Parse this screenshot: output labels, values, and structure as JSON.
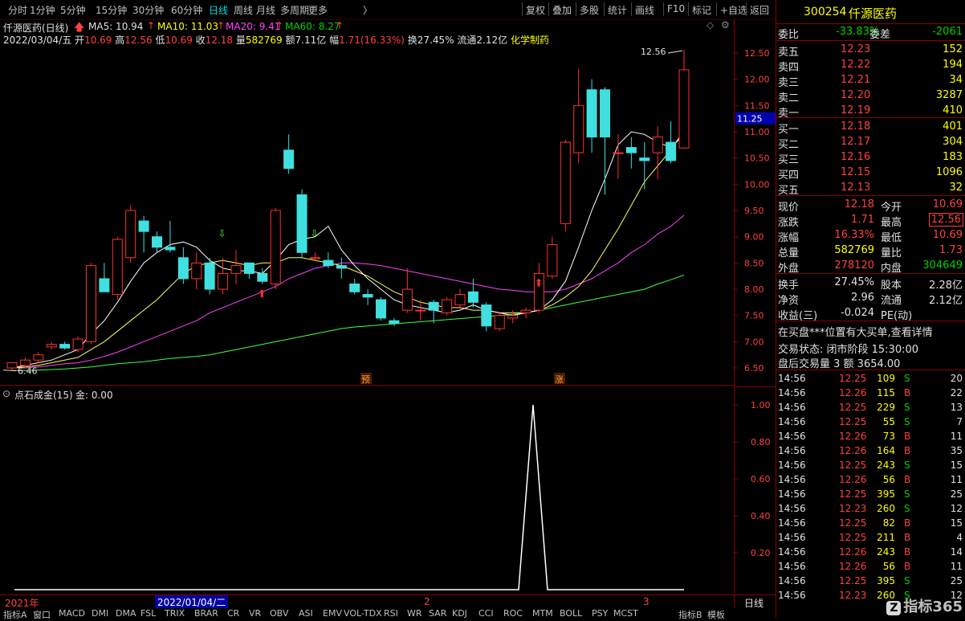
{
  "toolbar": {
    "periods": [
      "分时",
      "1分钟",
      "5分钟",
      "15分钟",
      "30分钟",
      "60分钟",
      "日线",
      "周线",
      "月线",
      "多周期",
      "更多"
    ],
    "active_period": "日线",
    "actions": [
      "复权",
      "叠加",
      "多股",
      "统计",
      "画线",
      "F10",
      "标记",
      "+自选",
      "返回"
    ]
  },
  "info": {
    "title": "仟源医药(日线)",
    "ma5": "MA5: 10.94",
    "ma10": "MA10: 11.03",
    "ma20": "MA20: 9.41",
    "ma60": "MA60: 8.27",
    "date": "2022/03/04/五",
    "open_label": "开",
    "open": "10.69",
    "high_label": "高",
    "high": "12.56",
    "low_label": "低",
    "low": "10.69",
    "close_label": "收",
    "close": "12.18",
    "vol_label": "量",
    "vol": "582769",
    "amount_label": "额",
    "amount": "7.11亿",
    "change_label": "幅",
    "change": "1.71(16.33%)",
    "turnover_label": "换",
    "turnover": "27.45%",
    "float_label": "流通",
    "float": "2.12亿",
    "sector": "化学制药"
  },
  "price_axis": {
    "ticks": [
      "12.50",
      "12.00",
      "11.50",
      "11.00",
      "10.50",
      "10.00",
      "9.50",
      "9.00",
      "8.50",
      "8.00",
      "7.50",
      "7.00",
      "6.50"
    ],
    "current": "11.25",
    "high_mark": "12.56",
    "low_mark": "6.46"
  },
  "markers": {
    "pre": "预",
    "up": "涨"
  },
  "indicator": {
    "title": "点石成金(15)",
    "value_label": "金: 0.00",
    "ticks": [
      "1.00",
      "0.80",
      "0.60",
      "0.40",
      "0.20"
    ]
  },
  "date_axis": {
    "labels": [
      "2021年",
      "2022/01/04/二",
      "2",
      "3"
    ],
    "right": "日线"
  },
  "bottom_tabs": [
    "指标A",
    "窗口",
    "MACD",
    "DMI",
    "DMA",
    "FSL",
    "TRIX",
    "BRAR",
    "CR",
    "VR",
    "OBV",
    "ASI",
    "EMV",
    "VOL-TDX",
    "RSI",
    "WR",
    "SAR",
    "KDJ",
    "CCI",
    "ROC",
    "MTM",
    "BOLL",
    "PSY",
    "MCST",
    "指标B",
    "模板"
  ],
  "quote": {
    "code": "300254",
    "name": "仟源医药",
    "webi_label": "委比",
    "webi": "-33.83%",
    "weicha_label": "委差",
    "weicha": "-2061",
    "asks": [
      {
        "label": "卖五",
        "price": "12.23",
        "vol": "152"
      },
      {
        "label": "卖四",
        "price": "12.22",
        "vol": "194"
      },
      {
        "label": "卖三",
        "price": "12.21",
        "vol": "34"
      },
      {
        "label": "卖二",
        "price": "12.20",
        "vol": "3287"
      },
      {
        "label": "卖一",
        "price": "12.19",
        "vol": "410"
      }
    ],
    "bids": [
      {
        "label": "买一",
        "price": "12.18",
        "vol": "401"
      },
      {
        "label": "买二",
        "price": "12.17",
        "vol": "304"
      },
      {
        "label": "买三",
        "price": "12.16",
        "vol": "183"
      },
      {
        "label": "买四",
        "price": "12.15",
        "vol": "1096"
      },
      {
        "label": "买五",
        "price": "12.13",
        "vol": "32"
      }
    ],
    "stats": [
      {
        "l1": "现价",
        "v1": "12.18",
        "l2": "今开",
        "v2": "10.69"
      },
      {
        "l1": "涨跌",
        "v1": "1.71",
        "l2": "最高",
        "v2": "12.56"
      },
      {
        "l1": "涨幅",
        "v1": "16.33%",
        "l2": "最低",
        "v2": "10.69"
      },
      {
        "l1": "总量",
        "v1": "582769",
        "l2": "量比",
        "v2": "1.73"
      },
      {
        "l1": "外盘",
        "v1": "278120",
        "l2": "内盘",
        "v2": "304649"
      }
    ],
    "stats2": [
      {
        "l1": "换手",
        "v1": "27.45%",
        "l2": "股本",
        "v2": "2.28亿"
      },
      {
        "l1": "净资",
        "v1": "2.96",
        "l2": "流通",
        "v2": "2.12亿"
      },
      {
        "l1": "收益(三)",
        "v1": "-0.024",
        "l2": "PE(动)",
        "v2": ""
      }
    ],
    "notice": "在买盘***位置有大买单,查看详情",
    "trade_status": "交易状态: 闭市阶段 15:30:00",
    "after_hours": "盘后交易量 3 额 3654.00"
  },
  "ticks": [
    {
      "t": "14:56",
      "p": "12.25",
      "v": "109",
      "s": "S",
      "n": "20"
    },
    {
      "t": "14:56",
      "p": "12.26",
      "v": "115",
      "s": "B",
      "n": "22"
    },
    {
      "t": "14:56",
      "p": "12.25",
      "v": "229",
      "s": "S",
      "n": "13"
    },
    {
      "t": "14:56",
      "p": "12.25",
      "v": "55",
      "s": "S",
      "n": "7"
    },
    {
      "t": "14:56",
      "p": "12.26",
      "v": "73",
      "s": "B",
      "n": "11"
    },
    {
      "t": "14:56",
      "p": "12.26",
      "v": "164",
      "s": "B",
      "n": "35"
    },
    {
      "t": "14:56",
      "p": "12.25",
      "v": "243",
      "s": "S",
      "n": "15"
    },
    {
      "t": "14:56",
      "p": "12.26",
      "v": "56",
      "s": "B",
      "n": "11"
    },
    {
      "t": "14:56",
      "p": "12.25",
      "v": "395",
      "s": "S",
      "n": "25"
    },
    {
      "t": "14:56",
      "p": "12.23",
      "v": "260",
      "s": "S",
      "n": "12"
    },
    {
      "t": "14:56",
      "p": "12.25",
      "v": "82",
      "s": "B",
      "n": "15"
    },
    {
      "t": "14:56",
      "p": "12.25",
      "v": "211",
      "s": "B",
      "n": "4"
    },
    {
      "t": "14:56",
      "p": "12.26",
      "v": "243",
      "s": "B",
      "n": "14"
    },
    {
      "t": "14:56",
      "p": "12.26",
      "v": "56",
      "s": "B",
      "n": "11"
    },
    {
      "t": "14:56",
      "p": "12.25",
      "v": "395",
      "s": "S",
      "n": "25"
    },
    {
      "t": "14:56",
      "p": "12.23",
      "v": "260",
      "s": "S",
      "n": "12"
    }
  ],
  "watermark": "指标365",
  "colors": {
    "up": "#ff3030",
    "down": "#40e0e0",
    "ma5": "#ffffff",
    "ma10": "#ffff60",
    "ma20": "#ff40ff",
    "ma60": "#40ff40",
    "grid": "#8a0000"
  },
  "chart_data": {
    "type": "candlestick",
    "ylim": [
      6.3,
      12.7
    ],
    "candles": [
      {
        "o": 6.5,
        "h": 6.6,
        "l": 6.46,
        "c": 6.6
      },
      {
        "o": 6.55,
        "h": 6.7,
        "l": 6.5,
        "c": 6.65
      },
      {
        "o": 6.65,
        "h": 6.8,
        "l": 6.6,
        "c": 6.75
      },
      {
        "o": 6.9,
        "h": 7.0,
        "l": 6.85,
        "c": 6.95
      },
      {
        "o": 6.95,
        "h": 7.0,
        "l": 6.85,
        "c": 6.88
      },
      {
        "o": 6.85,
        "h": 7.1,
        "l": 6.8,
        "c": 7.05
      },
      {
        "o": 7.0,
        "h": 8.5,
        "l": 6.95,
        "c": 8.45
      },
      {
        "o": 8.2,
        "h": 8.5,
        "l": 8.0,
        "c": 7.95
      },
      {
        "o": 7.9,
        "h": 9.0,
        "l": 7.8,
        "c": 8.95
      },
      {
        "o": 8.6,
        "h": 9.6,
        "l": 8.5,
        "c": 9.5
      },
      {
        "o": 9.3,
        "h": 9.4,
        "l": 8.7,
        "c": 9.1
      },
      {
        "o": 9.0,
        "h": 9.1,
        "l": 8.7,
        "c": 8.8
      },
      {
        "o": 8.8,
        "h": 9.3,
        "l": 8.7,
        "c": 8.75
      },
      {
        "o": 8.6,
        "h": 8.8,
        "l": 8.1,
        "c": 8.2
      },
      {
        "o": 8.2,
        "h": 8.7,
        "l": 8.0,
        "c": 8.5
      },
      {
        "o": 8.5,
        "h": 8.6,
        "l": 7.9,
        "c": 8.0
      },
      {
        "o": 8.0,
        "h": 8.6,
        "l": 7.9,
        "c": 8.3
      },
      {
        "o": 8.3,
        "h": 8.75,
        "l": 8.1,
        "c": 8.45
      },
      {
        "o": 8.5,
        "h": 8.5,
        "l": 8.2,
        "c": 8.3
      },
      {
        "o": 8.3,
        "h": 8.4,
        "l": 8.1,
        "c": 8.15
      },
      {
        "o": 8.1,
        "h": 9.55,
        "l": 8.0,
        "c": 9.5
      },
      {
        "o": 10.65,
        "h": 10.95,
        "l": 10.2,
        "c": 10.3
      },
      {
        "o": 9.8,
        "h": 9.9,
        "l": 8.6,
        "c": 8.7
      },
      {
        "o": 8.6,
        "h": 8.7,
        "l": 8.55,
        "c": 8.6
      },
      {
        "o": 8.55,
        "h": 8.7,
        "l": 8.4,
        "c": 8.45
      },
      {
        "o": 8.45,
        "h": 8.6,
        "l": 8.2,
        "c": 8.4
      },
      {
        "o": 8.1,
        "h": 8.2,
        "l": 7.9,
        "c": 7.95
      },
      {
        "o": 7.9,
        "h": 8.0,
        "l": 7.7,
        "c": 7.85
      },
      {
        "o": 7.8,
        "h": 7.85,
        "l": 7.4,
        "c": 7.45
      },
      {
        "o": 7.4,
        "h": 7.45,
        "l": 7.3,
        "c": 7.35
      },
      {
        "o": 7.6,
        "h": 8.4,
        "l": 7.55,
        "c": 8.0
      },
      {
        "o": 7.6,
        "h": 7.8,
        "l": 7.4,
        "c": 7.6
      },
      {
        "o": 7.75,
        "h": 7.8,
        "l": 7.35,
        "c": 7.6
      },
      {
        "o": 7.55,
        "h": 7.85,
        "l": 7.5,
        "c": 7.8
      },
      {
        "o": 7.7,
        "h": 8.0,
        "l": 7.6,
        "c": 7.9
      },
      {
        "o": 7.95,
        "h": 8.2,
        "l": 7.65,
        "c": 7.75
      },
      {
        "o": 7.7,
        "h": 7.75,
        "l": 7.2,
        "c": 7.3
      },
      {
        "o": 7.25,
        "h": 7.55,
        "l": 7.2,
        "c": 7.5
      },
      {
        "o": 7.45,
        "h": 7.6,
        "l": 7.35,
        "c": 7.5
      },
      {
        "o": 7.55,
        "h": 7.65,
        "l": 7.45,
        "c": 7.6
      },
      {
        "o": 7.6,
        "h": 8.5,
        "l": 7.55,
        "c": 8.3
      },
      {
        "o": 8.25,
        "h": 9.0,
        "l": 8.2,
        "c": 8.85
      },
      {
        "o": 9.25,
        "h": 10.85,
        "l": 9.1,
        "c": 10.8
      },
      {
        "o": 10.6,
        "h": 12.2,
        "l": 10.4,
        "c": 11.5
      },
      {
        "o": 11.8,
        "h": 12.0,
        "l": 10.6,
        "c": 10.9
      },
      {
        "o": 11.8,
        "h": 11.85,
        "l": 9.8,
        "c": 10.9
      },
      {
        "o": 10.6,
        "h": 10.95,
        "l": 10.1,
        "c": 10.6
      },
      {
        "o": 10.7,
        "h": 10.9,
        "l": 10.3,
        "c": 10.6
      },
      {
        "o": 10.5,
        "h": 10.8,
        "l": 9.9,
        "c": 10.45
      },
      {
        "o": 10.6,
        "h": 11.1,
        "l": 10.1,
        "c": 10.9
      },
      {
        "o": 10.8,
        "h": 11.2,
        "l": 10.4,
        "c": 10.45
      },
      {
        "o": 10.69,
        "h": 12.56,
        "l": 10.69,
        "c": 12.18
      }
    ],
    "ma5": [
      6.5,
      6.55,
      6.6,
      6.65,
      6.75,
      6.85,
      7.15,
      7.4,
      7.75,
      8.15,
      8.5,
      8.7,
      8.85,
      8.9,
      8.8,
      8.55,
      8.4,
      8.35,
      8.35,
      8.3,
      8.55,
      8.85,
      8.95,
      9.0,
      9.2,
      8.75,
      8.45,
      8.2,
      8.0,
      7.8,
      7.7,
      7.65,
      7.6,
      7.55,
      7.6,
      7.7,
      7.6,
      7.55,
      7.5,
      7.55,
      7.6,
      7.8,
      8.15,
      8.8,
      9.5,
      10.1,
      10.75,
      11.0,
      10.95,
      10.8,
      10.7,
      10.94
    ],
    "ma10": [
      6.5,
      6.52,
      6.55,
      6.6,
      6.65,
      6.7,
      6.85,
      7.0,
      7.2,
      7.4,
      7.6,
      7.8,
      8.05,
      8.3,
      8.45,
      8.5,
      8.55,
      8.5,
      8.45,
      8.5,
      8.5,
      8.6,
      8.6,
      8.55,
      8.5,
      8.45,
      8.35,
      8.25,
      8.1,
      7.95,
      7.85,
      7.75,
      7.7,
      7.65,
      7.65,
      7.6,
      7.6,
      7.55,
      7.55,
      7.55,
      7.6,
      7.7,
      7.85,
      8.05,
      8.35,
      8.75,
      9.15,
      9.6,
      10.05,
      10.35,
      10.65,
      11.03
    ],
    "ma20": [
      6.5,
      6.5,
      6.52,
      6.55,
      6.58,
      6.6,
      6.65,
      6.72,
      6.8,
      6.9,
      7.0,
      7.1,
      7.2,
      7.3,
      7.4,
      7.55,
      7.65,
      7.75,
      7.85,
      7.95,
      8.05,
      8.2,
      8.3,
      8.4,
      8.45,
      8.5,
      8.5,
      8.48,
      8.45,
      8.4,
      8.35,
      8.3,
      8.25,
      8.2,
      8.15,
      8.1,
      8.05,
      8.0,
      7.98,
      7.95,
      7.95,
      7.95,
      8.0,
      8.1,
      8.2,
      8.35,
      8.5,
      8.7,
      8.85,
      9.05,
      9.2,
      9.41
    ],
    "ma60": [
      6.45,
      6.45,
      6.46,
      6.47,
      6.48,
      6.5,
      6.52,
      6.55,
      6.58,
      6.6,
      6.62,
      6.65,
      6.68,
      6.7,
      6.72,
      6.75,
      6.8,
      6.85,
      6.9,
      6.95,
      7.0,
      7.05,
      7.1,
      7.15,
      7.2,
      7.25,
      7.28,
      7.3,
      7.32,
      7.34,
      7.36,
      7.38,
      7.4,
      7.42,
      7.44,
      7.46,
      7.48,
      7.5,
      7.52,
      7.55,
      7.6,
      7.65,
      7.7,
      7.75,
      7.8,
      7.85,
      7.9,
      7.95,
      8.0,
      8.1,
      8.18,
      8.27
    ],
    "indicator": [
      0,
      0,
      0,
      0,
      0,
      0,
      0,
      0,
      0,
      0,
      0,
      0,
      0,
      0,
      0,
      0,
      0,
      0,
      0,
      0,
      0,
      0,
      0,
      0,
      0,
      0,
      0,
      0,
      0,
      0,
      0,
      0,
      0,
      0,
      0,
      0,
      0,
      0,
      0,
      1,
      0,
      0,
      0,
      0,
      0,
      0,
      0,
      0,
      0,
      0,
      0,
      0
    ]
  }
}
